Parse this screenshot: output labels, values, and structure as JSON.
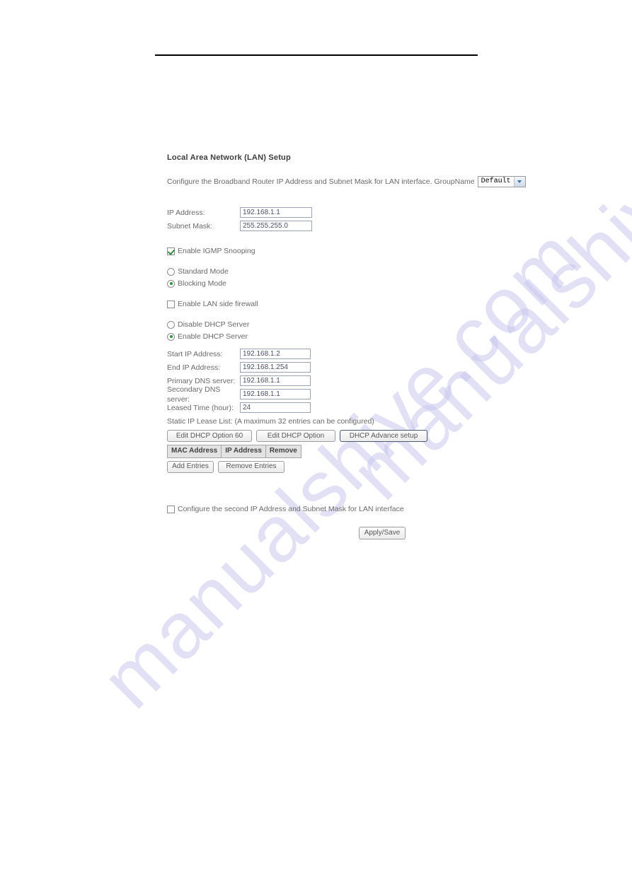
{
  "watermark": {
    "text": "manualshive.com"
  },
  "form": {
    "section_title": "Local Area Network (LAN) Setup",
    "intro_text": "Configure the Broadband Router IP Address and Subnet Mask for LAN interface. GroupName",
    "group_name_select": {
      "value": "Default",
      "arrow_icon": "chevron-down-icon"
    },
    "lan_fields": [
      {
        "label": "IP Address:",
        "value": "192.168.1.1"
      },
      {
        "label": "Subnet Mask:",
        "value": "255.255.255.0"
      }
    ],
    "igmp_snooping": {
      "label": "Enable IGMP Snooping",
      "checked": true
    },
    "igmp_modes": [
      {
        "label": "Standard Mode",
        "selected": false
      },
      {
        "label": "Blocking Mode",
        "selected": true
      }
    ],
    "lan_firewall": {
      "label": "Enable LAN side firewall",
      "checked": false
    },
    "dhcp_modes": [
      {
        "label": "Disable DHCP Server",
        "selected": false
      },
      {
        "label": "Enable DHCP Server",
        "selected": true
      }
    ],
    "dhcp_fields": [
      {
        "label": "Start IP Address:",
        "value": "192.168.1.2"
      },
      {
        "label": "End IP Address:",
        "value": "192.168.1.254"
      },
      {
        "label": "Primary DNS server:",
        "value": "192.168.1.1"
      },
      {
        "label": "Secondary DNS server:",
        "value": "192.168.1.1"
      },
      {
        "label": "Leased Time (hour):",
        "value": "24"
      }
    ],
    "lease_note": "Static IP Lease List: (A maximum 32 entries can be configured)",
    "dhcp_buttons": [
      {
        "label": "Edit DHCP Option 60"
      },
      {
        "label": "Edit DHCP Option"
      },
      {
        "label": "DHCP Advance setup"
      }
    ],
    "lease_table": {
      "headers": [
        "MAC Address",
        "IP Address",
        "Remove"
      ],
      "rows": []
    },
    "entry_buttons": [
      {
        "label": "Add Entries"
      },
      {
        "label": "Remove Entries"
      }
    ],
    "second_ip": {
      "label": "Configure the second IP Address and Subnet Mask for LAN interface",
      "checked": false
    },
    "apply_button": {
      "label": "Apply/Save"
    }
  }
}
